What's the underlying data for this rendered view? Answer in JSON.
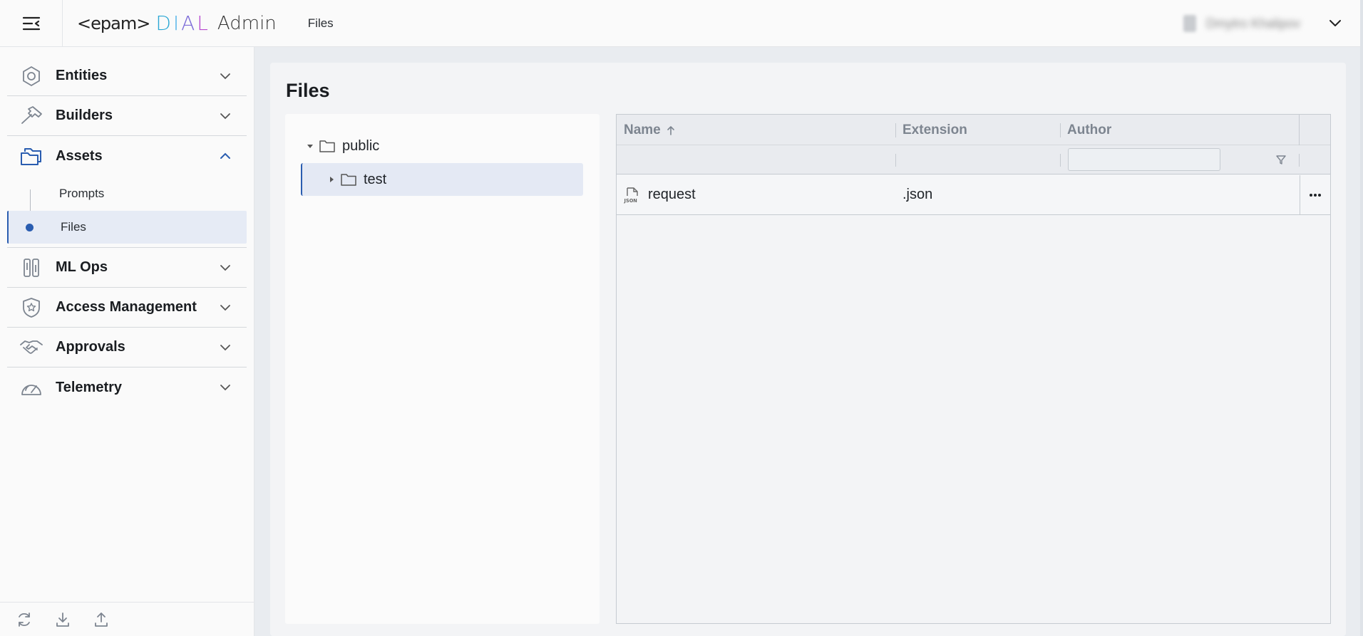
{
  "header": {
    "logo_epam": "<epam>",
    "logo_dial": [
      "D",
      "I",
      "A",
      "L"
    ],
    "logo_admin": "Admin",
    "breadcrumb": "Files",
    "user_name": "Dmytro Khalipov"
  },
  "sidebar": {
    "items": [
      {
        "label": "Entities",
        "icon": "hexagon-icon",
        "expanded": false
      },
      {
        "label": "Builders",
        "icon": "hammer-icon",
        "expanded": false
      },
      {
        "label": "Assets",
        "icon": "folders-icon",
        "expanded": true
      },
      {
        "label": "ML Ops",
        "icon": "ml-ops-icon",
        "expanded": false
      },
      {
        "label": "Access Management",
        "icon": "shield-star-icon",
        "expanded": false
      },
      {
        "label": "Approvals",
        "icon": "handshake-icon",
        "expanded": false
      },
      {
        "label": "Telemetry",
        "icon": "gauge-icon",
        "expanded": false
      }
    ],
    "assets_children": [
      {
        "label": "Prompts",
        "active": false
      },
      {
        "label": "Files",
        "active": true
      }
    ]
  },
  "main": {
    "title": "Files",
    "tree": {
      "root": "public",
      "children": [
        {
          "label": "test",
          "selected": true
        }
      ]
    },
    "grid": {
      "columns": [
        {
          "label": "Name",
          "sorted": "asc"
        },
        {
          "label": "Extension"
        },
        {
          "label": "Author"
        }
      ],
      "author_filter_value": "",
      "rows": [
        {
          "name": "request",
          "extension": ".json",
          "author": "",
          "file_icon": "json-file-icon"
        }
      ]
    }
  },
  "colors": {
    "accent": "#2a5db0",
    "active_bg": "#e6ebf5"
  }
}
